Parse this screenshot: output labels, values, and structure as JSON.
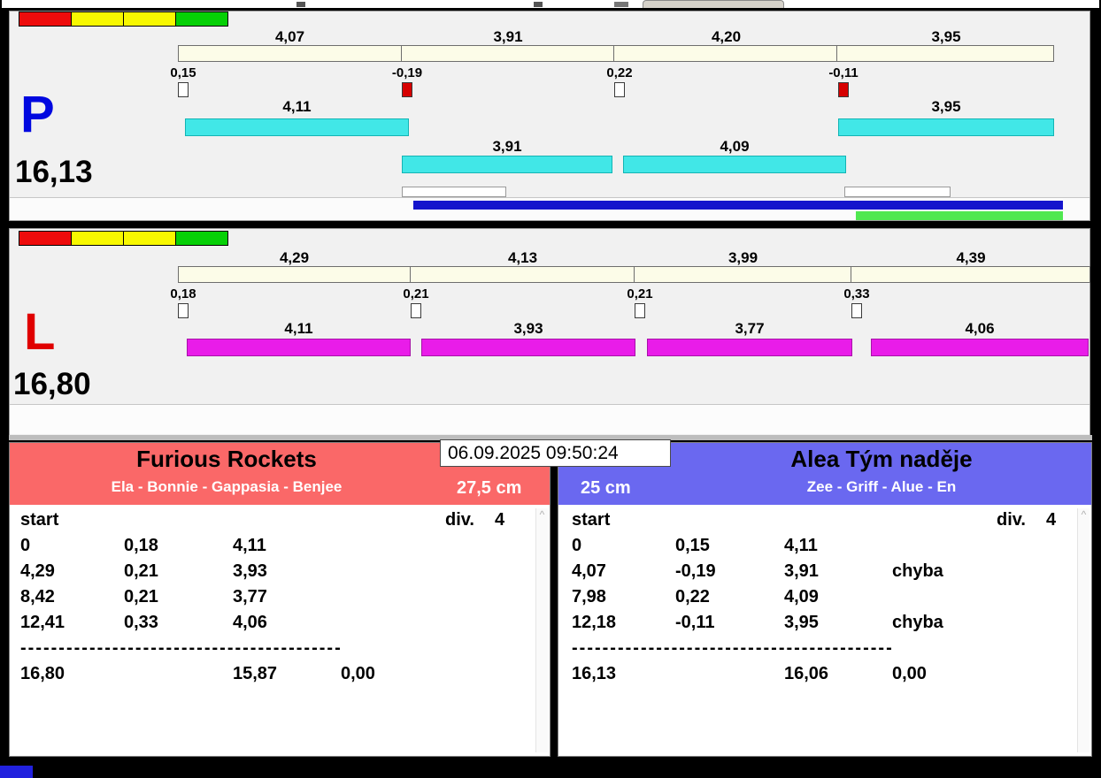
{
  "lanes": {
    "p": {
      "letter": "P",
      "total": "16,13",
      "top_splits": [
        "4,07",
        "3,91",
        "4,20",
        "3,95"
      ],
      "deltas": [
        "0,15",
        "-0,19",
        "0,22",
        "-0,11"
      ],
      "faults": [
        false,
        true,
        false,
        true
      ],
      "bottom_splits": [
        "4,11",
        "3,91",
        "4,09",
        "3,95"
      ]
    },
    "l": {
      "letter": "L",
      "total": "16,80",
      "top_splits": [
        "4,29",
        "4,13",
        "3,99",
        "4,39"
      ],
      "deltas": [
        "0,18",
        "0,21",
        "0,21",
        "0,33"
      ],
      "faults": [
        false,
        false,
        false,
        false
      ],
      "bottom_splits": [
        "4,11",
        "3,93",
        "3,77",
        "4,06"
      ]
    }
  },
  "timestamp": "06.09.2025 09:50:24",
  "teams": {
    "left": {
      "name": "Furious Rockets",
      "dogs": "Ela - Bonnie - Gappasia - Benjee",
      "height": "27,5 cm",
      "start_label": "start",
      "division_label": "div.",
      "division_value": "4",
      "rows": [
        {
          "t": "0",
          "d": "0,18",
          "s": "4,11",
          "note": ""
        },
        {
          "t": "4,29",
          "d": "0,21",
          "s": "3,93",
          "note": ""
        },
        {
          "t": "8,42",
          "d": "0,21",
          "s": "3,77",
          "note": ""
        },
        {
          "t": "12,41",
          "d": "0,33",
          "s": "4,06",
          "note": ""
        }
      ],
      "separator": "------------------------------------------",
      "total": "16,80",
      "sum": "15,87",
      "penalty": "0,00"
    },
    "right": {
      "name": "Alea Tým naděje",
      "dogs": "Zee - Griff - Alue - En",
      "height": "25 cm",
      "start_label": "start",
      "division_label": "div.",
      "division_value": "4",
      "rows": [
        {
          "t": "0",
          "d": "0,15",
          "s": "4,11",
          "note": ""
        },
        {
          "t": "4,07",
          "d": "-0,19",
          "s": "3,91",
          "note": "chyba"
        },
        {
          "t": "7,98",
          "d": "0,22",
          "s": "4,09",
          "note": ""
        },
        {
          "t": "12,18",
          "d": "-0,11",
          "s": "3,95",
          "note": "chyba"
        }
      ],
      "separator": "------------------------------------------",
      "total": "16,13",
      "sum": "16,06",
      "penalty": "0,00"
    }
  },
  "icons": {
    "scroll_up": "^"
  },
  "colors": {
    "cyan_bar": "#41e7e7",
    "magenta_bar": "#e91ce9",
    "finish_blue": "#1414cc",
    "finish_green": "#50e850",
    "fault_red": "#d60000",
    "header_left_red": "#fa6868",
    "header_right_blue": "#6a68f0",
    "legend": [
      "#ee0c0c",
      "#f8f800",
      "#f8f800",
      "#06d006"
    ],
    "letter_p": "#0008e0",
    "letter_l": "#e00000"
  }
}
